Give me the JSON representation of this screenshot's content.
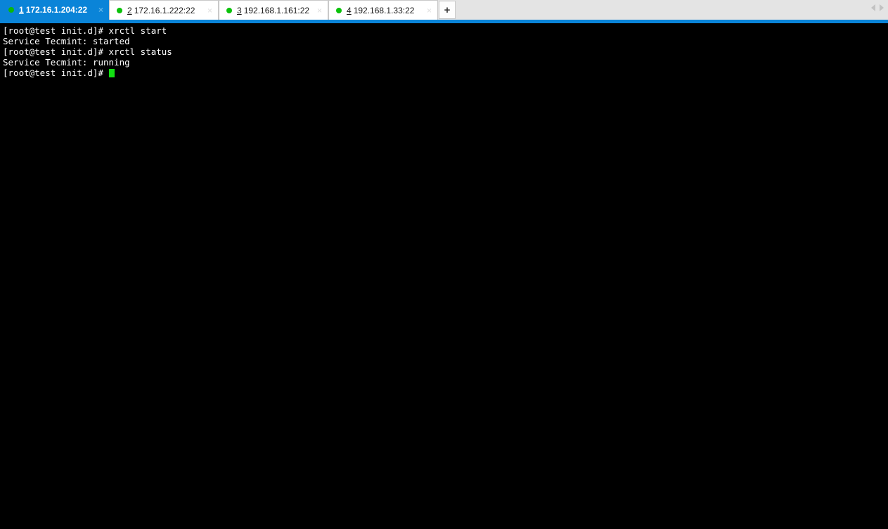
{
  "tabbar": {
    "tabs": [
      {
        "number": "1",
        "title": "172.16.1.204:22",
        "status_icon": "green-dot-icon",
        "close_icon": "×",
        "active": true
      },
      {
        "number": "2",
        "title": "172.16.1.222:22",
        "status_icon": "green-dot-icon",
        "close_icon": "×",
        "active": false
      },
      {
        "number": "3",
        "title": "192.168.1.161:22",
        "status_icon": "green-dot-icon",
        "close_icon": "×",
        "active": false
      },
      {
        "number": "4",
        "title": "192.168.1.33:22",
        "status_icon": "green-dot-icon",
        "close_icon": "×",
        "active": false
      }
    ],
    "new_tab_label": "+",
    "scroll_left_icon": "triangle-left-icon",
    "scroll_right_icon": "triangle-right-icon",
    "active_tab_color": "#0a84d8",
    "status_dot_color": "#0ac20a",
    "bar_background": "#e4e4e4"
  },
  "terminal": {
    "background": "#000000",
    "foreground": "#ffffff",
    "cursor_color": "#12e012",
    "lines": [
      "[root@test init.d]# xrctl start",
      "Service Tecmint: started",
      "[root@test init.d]# xrctl status",
      "Service Tecmint: running"
    ],
    "prompt": "[root@test init.d]# "
  }
}
